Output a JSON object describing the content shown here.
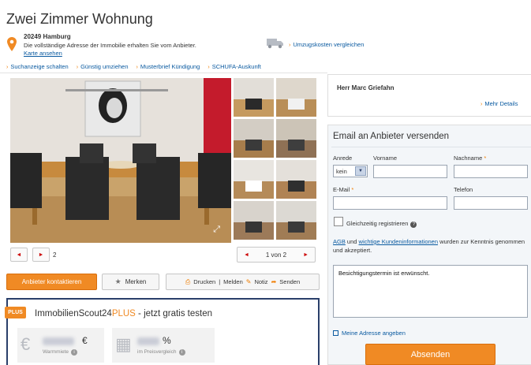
{
  "page": {
    "title": "Zwei Zimmer Wohnung"
  },
  "address": {
    "zip_city": "20249 Hamburg",
    "note": "Die vollständige Adresse der Immobilie erhalten Sie vom Anbieter.",
    "map_link": "Karte ansehen"
  },
  "moving": {
    "link": "Umzugskosten vergleichen"
  },
  "toplinks": [
    {
      "label": "Suchanzeige schalten"
    },
    {
      "label": "Günstig umziehen"
    },
    {
      "label": "Musterbrief Kündigung"
    },
    {
      "label": "SCHUFA-Auskunft"
    }
  ],
  "gallery": {
    "page_number": "2",
    "pager_label": "1 von 2"
  },
  "actions": {
    "contact_label": "Anbieter kontaktieren",
    "merken_label": "Merken",
    "drucken_label": "Drucken",
    "melden_label": "Melden",
    "notiz_label": "Notiz",
    "senden_label": "Senden"
  },
  "plus": {
    "badge": "PLUS",
    "title_prefix": "ImmobilienScout24",
    "title_plus": "PLUS",
    "title_suffix": " - jetzt gratis testen",
    "kpi1_unit": "€",
    "kpi1_label": "Warmmiete",
    "kpi2_unit": "%",
    "kpi2_label": "im Preisvergleich"
  },
  "contact": {
    "name": "Herr Marc Griefahn",
    "more_link": "Mehr Details"
  },
  "form": {
    "title": "Email an Anbieter versenden",
    "anrede_label": "Anrede",
    "anrede_value": "kein",
    "vorname_label": "Vorname",
    "nachname_label": "Nachname",
    "email_label": "E-Mail",
    "telefon_label": "Telefon",
    "register_label": "Gleichzeitig registrieren",
    "legal_agb": "AGB",
    "legal_und": " und ",
    "legal_kunden": "wichtige Kundeninformationen",
    "legal_rest": " wurden zur Kenntnis genommen und akzeptiert.",
    "message": "Besichtigungstermin ist erwünscht.",
    "address_link": "Meine Adresse angeben",
    "submit_label": "Absenden"
  },
  "colors": {
    "accent": "#f08a24",
    "link": "#0a5aa0",
    "plus_border": "#2a3f6a"
  }
}
